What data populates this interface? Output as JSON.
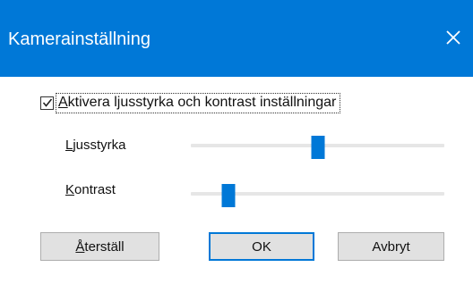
{
  "window": {
    "title": "Kamerainställning",
    "close_glyph": "✕"
  },
  "checkbox": {
    "checked": true,
    "label_first": "A",
    "label_rest": "ktivera ljusstyrka och kontrast inställningar"
  },
  "brightness": {
    "label_first": "L",
    "label_rest": "jusstyrka",
    "value_fraction": 0.5
  },
  "contrast": {
    "label_first": "K",
    "label_rest": "ontrast",
    "value_fraction": 0.15
  },
  "buttons": {
    "reset_first": "Å",
    "reset_rest": "terställ",
    "ok": "OK",
    "cancel": "Avbryt"
  },
  "colors": {
    "accent": "#0078d7",
    "button_face": "#e1e1e1",
    "track": "#e6e6e6"
  },
  "icons": {
    "close": "close-icon",
    "check": "checkmark-icon"
  }
}
